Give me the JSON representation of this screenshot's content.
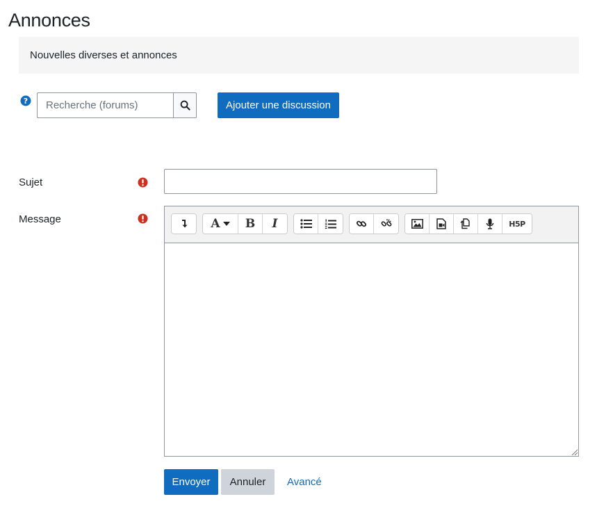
{
  "page": {
    "title": "Annonces"
  },
  "intro": {
    "text": "Nouvelles diverses et annonces"
  },
  "search": {
    "placeholder": "Recherche (forums)"
  },
  "actions": {
    "add_discussion": "Ajouter une discussion"
  },
  "form": {
    "subject_label": "Sujet",
    "message_label": "Message",
    "subject_value": "",
    "message_value": ""
  },
  "toolbar": {
    "icons": [
      "toolbar-toggle-icon",
      "font-style-icon",
      "bold-icon",
      "italic-icon",
      "unordered-list-icon",
      "ordered-list-icon",
      "link-icon",
      "unlink-icon",
      "image-icon",
      "media-icon",
      "manage-files-icon",
      "record-audio-icon",
      "h5p-icon"
    ],
    "bold_glyph": "B",
    "italic_glyph": "I",
    "font_glyph": "A",
    "h5p_label": "H5P"
  },
  "buttons": {
    "submit": "Envoyer",
    "cancel": "Annuler",
    "advanced": "Avancé"
  },
  "colors": {
    "primary": "#0f6cbf",
    "required": "#ca3120",
    "secondary": "#ced4da",
    "intro_bg": "#f5f5f5"
  }
}
